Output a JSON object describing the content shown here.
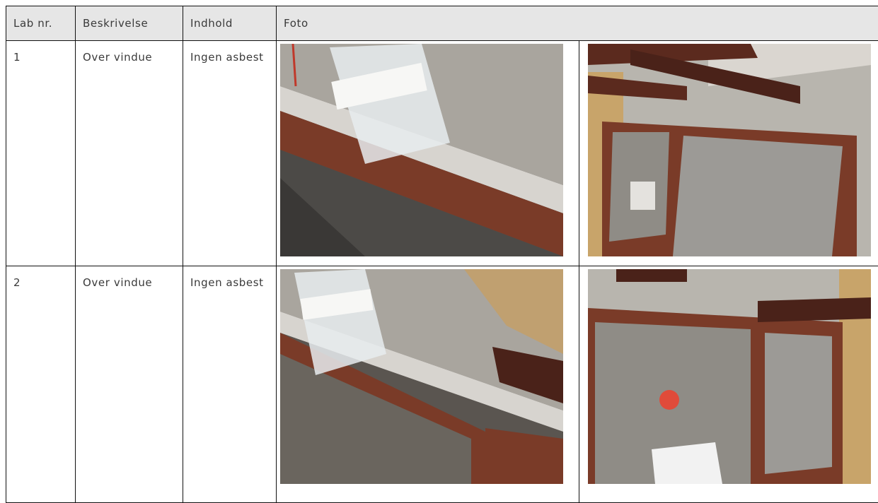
{
  "table": {
    "headers": [
      "Lab nr.",
      "Beskrivelse",
      "Indhold",
      "Foto"
    ],
    "rows": [
      {
        "lab": "1",
        "beskrivelse": "Over vindue",
        "indhold": "Ingen asbest",
        "photo_left": "sample bag on window frame",
        "photo_right": "window with brown beams"
      },
      {
        "lab": "2",
        "beskrivelse": "Over vindue",
        "indhold": "Ingen asbest",
        "photo_left": "sample bag on concrete over window",
        "photo_right": "window with brown beams"
      }
    ]
  },
  "colors": {
    "frame": "#7a3b28",
    "concrete": "#a8a49c",
    "header_bg": "#e6e6e6"
  }
}
